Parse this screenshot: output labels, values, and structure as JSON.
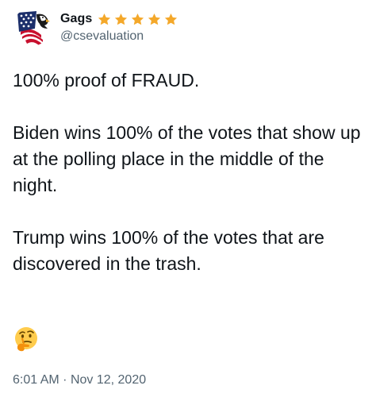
{
  "tweet": {
    "author": {
      "display_name": "Gags",
      "handle": "@csevaluation",
      "star_badges": [
        "star-icon",
        "star-icon",
        "star-icon",
        "star-icon",
        "star-icon"
      ],
      "star_color": "#f4a82a",
      "avatar_icon": "american-flag-avatar-icon"
    },
    "text": {
      "line1": "100% proof of FRAUD.",
      "para2": "Biden wins 100% of the votes that show up at the polling place in the middle of the night.",
      "para3": "Trump wins 100% of the votes that are discovered in the trash."
    },
    "emoji": "thinking-face-icon",
    "time": "6:01 AM",
    "separator": "·",
    "date": "Nov 12, 2020"
  },
  "colors": {
    "text_primary": "#0f1419",
    "text_secondary": "#536471",
    "star": "#f4a82a"
  }
}
